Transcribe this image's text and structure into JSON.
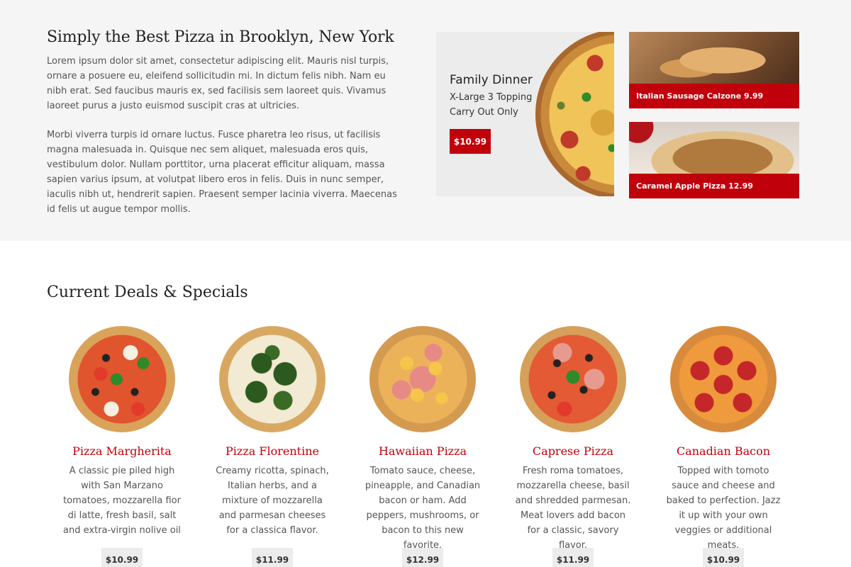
{
  "intro": {
    "title": "Simply the Best Pizza in Brooklyn, New York",
    "paragraph1": "Lorem ipsum dolor sit amet, consectetur adipiscing elit. Mauris nisl turpis, ornare a posuere eu, eleifend sollicitudin mi. In dictum felis nibh. Nam eu nibh erat. Sed faucibus mauris ex, sed facilisis sem laoreet quis. Vivamus laoreet purus a justo euismod suscipit cras at ultricies.",
    "paragraph2": "Morbi viverra turpis id ornare luctus. Fusce pharetra leo risus, ut facilisis magna malesuada in. Quisque nec sem aliquet, malesuada eros quis, vestibulum dolor. Nullam porttitor, urna placerat efficitur aliquam, massa sapien varius ipsum, at volutpat libero eros in felis. Duis in nunc semper, iaculis nibh ut, hendrerit sapien. Praesent semper lacinia viverra. Maecenas id felis ut augue tempor mollis."
  },
  "promo": {
    "title": "Family Dinner",
    "line1": "X-Large 3 Topping",
    "line2": "Carry Out Only",
    "price": "$10.99",
    "image_icon": "pizza-photo"
  },
  "side_cards": [
    {
      "label": "Italian Sausage Calzone 9.99",
      "image_icon": "calzone-photo"
    },
    {
      "label": "Caramel Apple Pizza 12.99",
      "image_icon": "dessert-pizza-photo"
    }
  ],
  "deals": {
    "title": "Current Deals & Specials",
    "items": [
      {
        "name": "Pizza Margherita",
        "description": "A classic pie piled high with San Marzano tomatoes, mozzarella fior di latte, fresh basil, salt and extra-virgin nolive oil",
        "price": "$10.99"
      },
      {
        "name": "Pizza Florentine",
        "description": "Creamy ricotta, spinach, Italian herbs, and a mixture of mozzarella and parmesan cheeses for a classica flavor.",
        "price": "$11.99"
      },
      {
        "name": "Hawaiian Pizza",
        "description": "Tomato sauce, cheese, pineapple, and Canadian bacon or ham. Add peppers, mushrooms, or bacon to this new favorite.",
        "price": "$12.99"
      },
      {
        "name": "Caprese Pizza",
        "description": "Fresh roma tomatoes, mozzarella cheese, basil and shredded parmesan. Meat lovers add bacon for a classic, savory flavor.",
        "price": "$11.99"
      },
      {
        "name": "Canadian Bacon",
        "description": "Topped with tomoto sauce and cheese and baked to perfection. Jazz it up with your own veggies or additional meats.",
        "price": "$10.99"
      }
    ]
  },
  "colors": {
    "accent": "#c0000a",
    "band_background": "#f5f5f5",
    "price_tag_background": "#ececec"
  }
}
